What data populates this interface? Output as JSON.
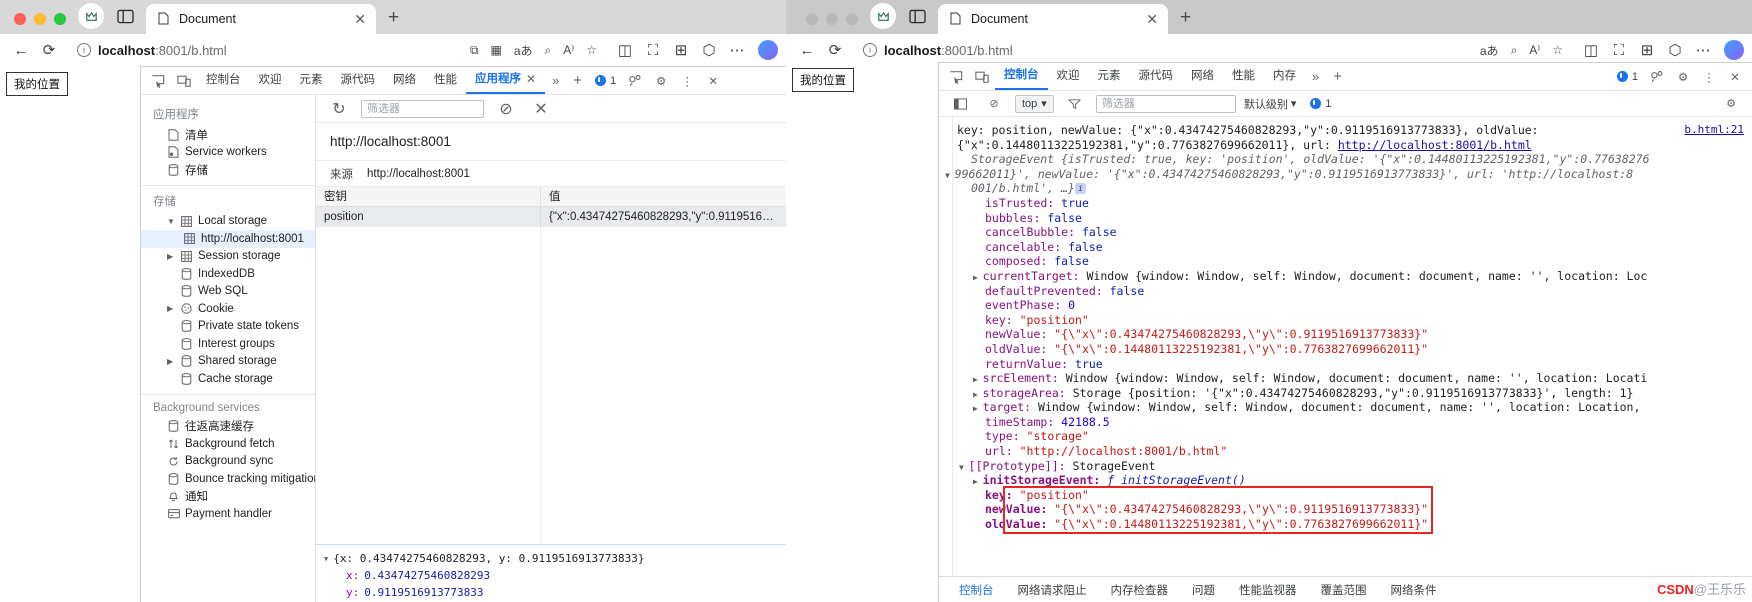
{
  "left_window": {
    "tab": {
      "label": "Document",
      "close": "✕",
      "new_tab": "+"
    },
    "omnibox": {
      "host": "localhost",
      "path": ":8001/b.html",
      "info_icon": "ⓘ"
    },
    "page_badge": "我的位置",
    "devtools": {
      "tabs": [
        {
          "label": "控制台",
          "active": false
        },
        {
          "label": "欢迎",
          "active": false
        },
        {
          "label": "元素",
          "active": false
        },
        {
          "label": "源代码",
          "active": false
        },
        {
          "label": "网络",
          "active": false
        },
        {
          "label": "性能",
          "active": false
        },
        {
          "label": "应用程序",
          "active": true
        }
      ],
      "more": "»",
      "add": "+",
      "issue_count": "1",
      "application_panel": {
        "groups": [
          {
            "title": "应用程序",
            "items": [
              {
                "label": "清单",
                "icon": "manifest-icon",
                "indent": 1,
                "arrow": "",
                "selected": false
              },
              {
                "label": "Service workers",
                "icon": "service-worker-icon",
                "indent": 1,
                "arrow": "",
                "selected": false
              },
              {
                "label": "存储",
                "icon": "database-icon",
                "indent": 1,
                "arrow": "",
                "selected": false
              }
            ]
          },
          {
            "title": "存储",
            "items": [
              {
                "label": "Local storage",
                "icon": "table-icon",
                "indent": 1,
                "arrow": "▼",
                "selected": false
              },
              {
                "label": "http://localhost:8001",
                "icon": "table-icon",
                "indent": 2,
                "arrow": "",
                "selected": true
              },
              {
                "label": "Session storage",
                "icon": "table-icon",
                "indent": 1,
                "arrow": "▶",
                "selected": false
              },
              {
                "label": "IndexedDB",
                "icon": "database-icon",
                "indent": 1,
                "arrow": "",
                "selected": false
              },
              {
                "label": "Web SQL",
                "icon": "database-icon",
                "indent": 1,
                "arrow": "",
                "selected": false
              },
              {
                "label": "Cookie",
                "icon": "cookie-icon",
                "indent": 1,
                "arrow": "▶",
                "selected": false
              },
              {
                "label": "Private state tokens",
                "icon": "database-icon",
                "indent": 1,
                "arrow": "",
                "selected": false
              },
              {
                "label": "Interest groups",
                "icon": "database-icon",
                "indent": 1,
                "arrow": "",
                "selected": false
              },
              {
                "label": "Shared storage",
                "icon": "database-icon",
                "indent": 1,
                "arrow": "▶",
                "selected": false
              },
              {
                "label": "Cache storage",
                "icon": "database-icon",
                "indent": 1,
                "arrow": "",
                "selected": false
              }
            ]
          },
          {
            "title": "Background services",
            "items": [
              {
                "label": "往返高速缓存",
                "icon": "database-icon",
                "indent": 1,
                "arrow": "",
                "selected": false
              },
              {
                "label": "Background fetch",
                "icon": "updown-arrows-icon",
                "indent": 1,
                "arrow": "",
                "selected": false
              },
              {
                "label": "Background sync",
                "icon": "sync-icon",
                "indent": 1,
                "arrow": "",
                "selected": false
              },
              {
                "label": "Bounce tracking mitigation",
                "icon": "database-icon",
                "indent": 1,
                "arrow": "",
                "selected": false
              },
              {
                "label": "通知",
                "icon": "bell-icon",
                "indent": 1,
                "arrow": "",
                "selected": false
              },
              {
                "label": "Payment handler",
                "icon": "card-icon",
                "indent": 1,
                "arrow": "",
                "selected": false
              }
            ]
          }
        ],
        "toolbar": {
          "refresh_icon": "↻",
          "filter_placeholder": "筛选器",
          "clear_icon": "⊘",
          "delete_icon": "✕"
        },
        "origin_title": "http://localhost:8001",
        "origin_label": "来源",
        "origin_value": "http://localhost:8001",
        "table": {
          "columns": [
            "密钥",
            "值"
          ],
          "rows": [
            {
              "key": "position",
              "value": "{\"x\":0.43474275460828293,\"y\":0.9119516…"
            }
          ]
        },
        "preview": {
          "root": "{x: 0.43474275460828293, y: 0.9119516913773833}",
          "entries": [
            {
              "key": "x:",
              "value": "0.43474275460828293"
            },
            {
              "key": "y:",
              "value": "0.9119516913773833"
            }
          ]
        }
      }
    }
  },
  "right_window": {
    "tab": {
      "label": "Document",
      "close": "✕",
      "new_tab": "+"
    },
    "omnibox": {
      "host": "localhost",
      "path": ":8001/b.html",
      "info_icon": "ⓘ"
    },
    "page_badge": "我的位置",
    "devtools": {
      "tabs": [
        {
          "label": "控制台",
          "active": true
        },
        {
          "label": "欢迎",
          "active": false
        },
        {
          "label": "元素",
          "active": false
        },
        {
          "label": "源代码",
          "active": false
        },
        {
          "label": "网络",
          "active": false
        },
        {
          "label": "性能",
          "active": false
        },
        {
          "label": "内存",
          "active": false
        }
      ],
      "more": "»",
      "add": "+",
      "issue_count": "1",
      "console_toolbar": {
        "context": "top",
        "filter_placeholder": "筛选器",
        "levels": "默认级别",
        "issue_count": "1",
        "settings_icon": "⚙"
      },
      "source_ref": "b.html:21",
      "lines": [
        {
          "indent": 0,
          "parts": [
            {
              "t": "key: position, newValue: ",
              "c": "plain"
            },
            {
              "t": "{\"x\":0.43474275460828293,\"y\":0.9119516913773833}, oldValue:",
              "c": "plain"
            }
          ]
        },
        {
          "indent": 0,
          "parts": [
            {
              "t": "{\"x\":0.14480113225192381,\"y\":0.7763827699662011}, url: ",
              "c": "plain"
            },
            {
              "t": "http://localhost:8001/b.html",
              "c": "lnk"
            }
          ]
        },
        {
          "indent": 1,
          "parts": [
            {
              "t": "StorageEvent {isTrusted: true, key: 'position', oldValue: '{\"x\":0.14480113225192381,\"y\":0.77638276",
              "c": "it"
            }
          ]
        },
        {
          "indent": 0,
          "arrow": "▼",
          "parts": [
            {
              "t": "99662011}', newValue: '{\"x\":0.43474275460828293,\"y\":0.9119516913773833}', url: 'http://localhost:8",
              "c": "it"
            }
          ]
        },
        {
          "indent": 1,
          "parts": [
            {
              "t": "001/b.html', …}",
              "c": "it"
            },
            {
              "t": " ℹ",
              "c": "ibadge"
            }
          ]
        },
        {
          "indent": 2,
          "parts": [
            {
              "t": "isTrusted: ",
              "c": "k"
            },
            {
              "t": "true",
              "c": "bl"
            }
          ]
        },
        {
          "indent": 2,
          "parts": [
            {
              "t": "bubbles: ",
              "c": "k"
            },
            {
              "t": "false",
              "c": "bl"
            }
          ]
        },
        {
          "indent": 2,
          "parts": [
            {
              "t": "cancelBubble: ",
              "c": "k"
            },
            {
              "t": "false",
              "c": "bl"
            }
          ]
        },
        {
          "indent": 2,
          "parts": [
            {
              "t": "cancelable: ",
              "c": "k"
            },
            {
              "t": "false",
              "c": "bl"
            }
          ]
        },
        {
          "indent": 2,
          "parts": [
            {
              "t": "composed: ",
              "c": "k"
            },
            {
              "t": "false",
              "c": "bl"
            }
          ]
        },
        {
          "indent": 2,
          "arrow": "▶",
          "parts": [
            {
              "t": "currentTarget: ",
              "c": "k"
            },
            {
              "t": "Window {window: Window, self: Window, document: document, name: '', location: Loc",
              "c": "plain"
            }
          ]
        },
        {
          "indent": 2,
          "parts": [
            {
              "t": "defaultPrevented: ",
              "c": "k"
            },
            {
              "t": "false",
              "c": "bl"
            }
          ]
        },
        {
          "indent": 2,
          "parts": [
            {
              "t": "eventPhase: ",
              "c": "k"
            },
            {
              "t": "0",
              "c": "n"
            }
          ]
        },
        {
          "indent": 2,
          "parts": [
            {
              "t": "key: ",
              "c": "k"
            },
            {
              "t": "\"position\"",
              "c": "s"
            }
          ]
        },
        {
          "indent": 2,
          "parts": [
            {
              "t": "newValue: ",
              "c": "k"
            },
            {
              "t": "\"{\\\"x\\\":0.43474275460828293,\\\"y\\\":0.9119516913773833}\"",
              "c": "s"
            }
          ]
        },
        {
          "indent": 2,
          "parts": [
            {
              "t": "oldValue: ",
              "c": "k"
            },
            {
              "t": "\"{\\\"x\\\":0.14480113225192381,\\\"y\\\":0.7763827699662011}\"",
              "c": "s"
            }
          ]
        },
        {
          "indent": 2,
          "parts": [
            {
              "t": "returnValue: ",
              "c": "k"
            },
            {
              "t": "true",
              "c": "bl"
            }
          ]
        },
        {
          "indent": 2,
          "arrow": "▶",
          "parts": [
            {
              "t": "srcElement: ",
              "c": "k"
            },
            {
              "t": "Window {window: Window, self: Window, document: document, name: '', location: Locati",
              "c": "plain"
            }
          ]
        },
        {
          "indent": 2,
          "arrow": "▶",
          "parts": [
            {
              "t": "storageArea: ",
              "c": "k"
            },
            {
              "t": "Storage {position: '{\"x\":0.43474275460828293,\"y\":0.9119516913773833}', length: 1}",
              "c": "plain"
            }
          ]
        },
        {
          "indent": 2,
          "arrow": "▶",
          "parts": [
            {
              "t": "target: ",
              "c": "k"
            },
            {
              "t": "Window {window: Window, self: Window, document: document, name: '', location: Location,",
              "c": "plain"
            }
          ]
        },
        {
          "indent": 2,
          "parts": [
            {
              "t": "timeStamp: ",
              "c": "k"
            },
            {
              "t": "42188.5",
              "c": "n"
            }
          ]
        },
        {
          "indent": 2,
          "parts": [
            {
              "t": "type: ",
              "c": "k"
            },
            {
              "t": "\"storage\"",
              "c": "s"
            }
          ]
        },
        {
          "indent": 2,
          "parts": [
            {
              "t": "url: ",
              "c": "k"
            },
            {
              "t": "\"http://localhost:8001/b.html\"",
              "c": "s"
            }
          ]
        },
        {
          "indent": 1,
          "arrow": "▼",
          "parts": [
            {
              "t": "[[Prototype]]: ",
              "c": "k"
            },
            {
              "t": "StorageEvent",
              "c": "plain"
            }
          ]
        },
        {
          "indent": 2,
          "arrow": "▶",
          "parts": [
            {
              "t": "initStorageEvent: ",
              "c": "kb"
            },
            {
              "t": "ƒ initStorageEvent()",
              "c": "fn"
            }
          ]
        },
        {
          "indent": 2,
          "parts": [
            {
              "t": "key: ",
              "c": "kb"
            },
            {
              "t": "\"position\"",
              "c": "s"
            }
          ]
        },
        {
          "indent": 2,
          "parts": [
            {
              "t": "newValue: ",
              "c": "kb"
            },
            {
              "t": "\"{\\\"x\\\":0.43474275460828293,\\\"y\\\":0.9119516913773833}\"",
              "c": "s"
            }
          ]
        },
        {
          "indent": 2,
          "parts": [
            {
              "t": "oldValue: ",
              "c": "kb"
            },
            {
              "t": "\"{\\\"x\\\":0.14480113225192381,\\\"y\\\":0.7763827699662011}\"",
              "c": "s"
            }
          ]
        }
      ],
      "drawer_tabs": [
        {
          "label": "控制台",
          "active": true
        },
        {
          "label": "网络请求阻止",
          "active": false
        },
        {
          "label": "内存检查器",
          "active": false
        },
        {
          "label": "问题",
          "active": false
        },
        {
          "label": "性能监视器",
          "active": false
        },
        {
          "label": "覆盖范围",
          "active": false
        },
        {
          "label": "网络条件",
          "active": false
        }
      ]
    }
  },
  "watermark": {
    "prefix": "CSDN",
    "suffix": "@王乐乐"
  },
  "colors": {
    "accent": "#1a73e8",
    "highlight": "#e8251e",
    "selected_row": "#e8f0fe"
  }
}
